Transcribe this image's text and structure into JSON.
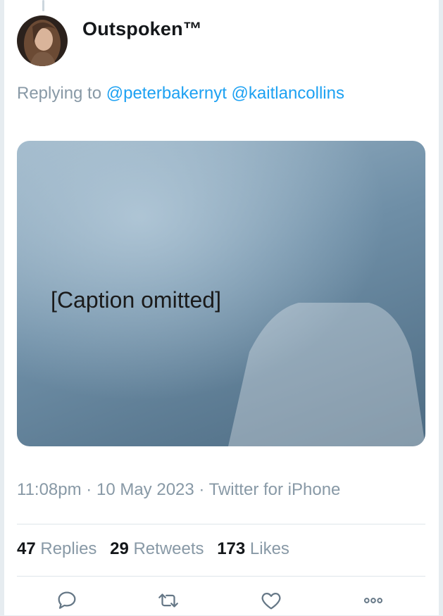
{
  "tweet": {
    "display_name": "Outspoken™",
    "reply_prefix": "Replying to",
    "mentions": [
      "@peterbakernyt",
      "@kaitlancollins"
    ],
    "media": {
      "caption_lines": [
        "[Caption omitted]"
      ]
    },
    "time": "11:08pm",
    "date": "10 May 2023",
    "source": "Twitter for iPhone",
    "separator": "·"
  },
  "stats": {
    "replies": {
      "count": "47",
      "label": "Replies"
    },
    "retweets": {
      "count": "29",
      "label": "Retweets"
    },
    "likes": {
      "count": "173",
      "label": "Likes"
    }
  },
  "actions": {
    "reply": "reply-icon",
    "retweet": "retweet-icon",
    "like": "heart-icon",
    "more": "more-icon"
  },
  "colors": {
    "accent": "#1da1f2",
    "muted": "#8899a6",
    "text": "#14171a",
    "divider": "#dfe5ea"
  }
}
